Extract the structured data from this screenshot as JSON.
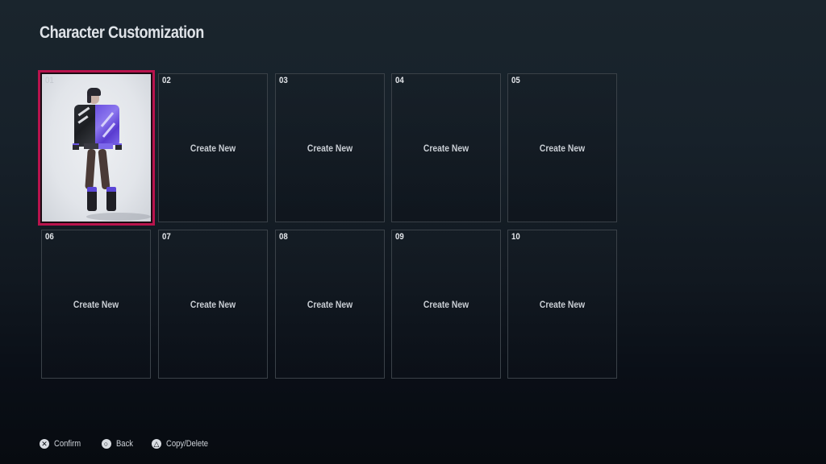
{
  "header": {
    "title": "Character Customization"
  },
  "accent_color": "#b8134d",
  "slots": [
    {
      "number": "01",
      "state": "filled",
      "selected": true,
      "label": ""
    },
    {
      "number": "02",
      "state": "empty",
      "selected": false,
      "label": "Create New"
    },
    {
      "number": "03",
      "state": "empty",
      "selected": false,
      "label": "Create New"
    },
    {
      "number": "04",
      "state": "empty",
      "selected": false,
      "label": "Create New"
    },
    {
      "number": "05",
      "state": "empty",
      "selected": false,
      "label": "Create New"
    },
    {
      "number": "06",
      "state": "empty",
      "selected": false,
      "label": "Create New"
    },
    {
      "number": "07",
      "state": "empty",
      "selected": false,
      "label": "Create New"
    },
    {
      "number": "08",
      "state": "empty",
      "selected": false,
      "label": "Create New"
    },
    {
      "number": "09",
      "state": "empty",
      "selected": false,
      "label": "Create New"
    },
    {
      "number": "10",
      "state": "empty",
      "selected": false,
      "label": "Create New"
    }
  ],
  "footer": {
    "hints": [
      {
        "icon": "cross-button-icon",
        "glyph": "✕",
        "label": "Confirm"
      },
      {
        "icon": "circle-button-icon",
        "glyph": "○",
        "label": "Back"
      },
      {
        "icon": "triangle-button-icon",
        "glyph": "△",
        "label": "Copy/Delete"
      }
    ]
  }
}
